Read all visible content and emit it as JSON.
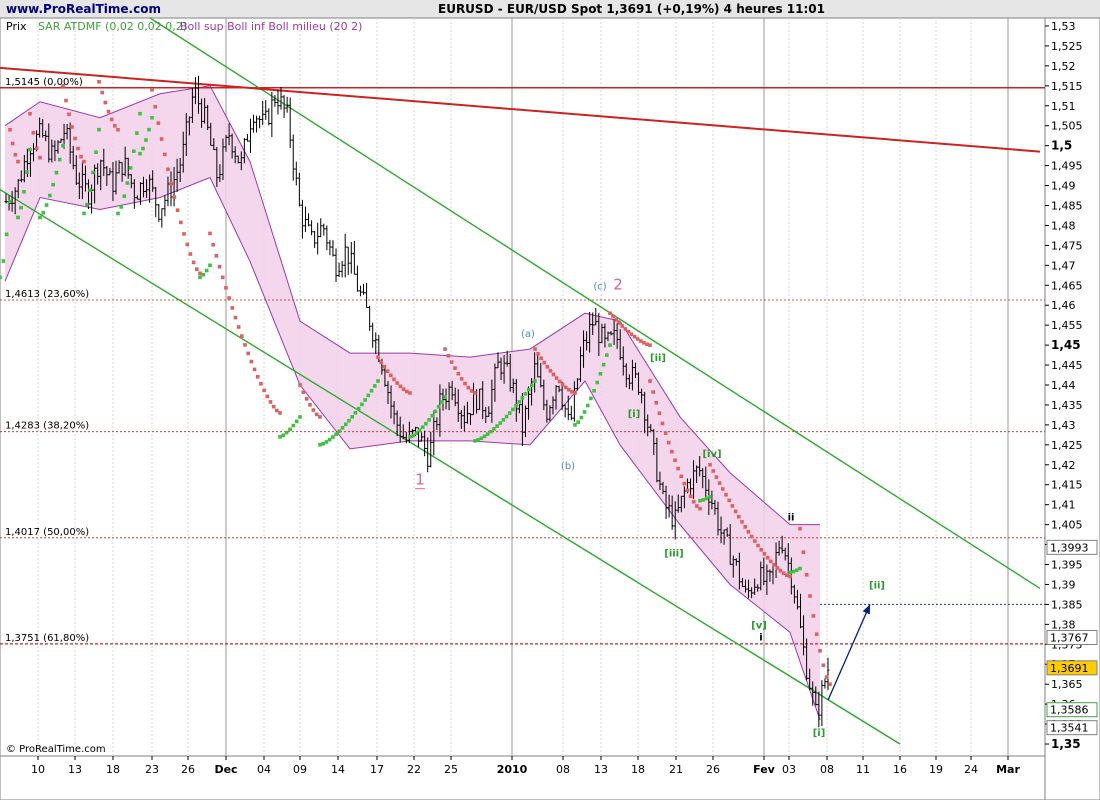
{
  "header": {
    "site": "www.ProRealTime.com",
    "title": "EURUSD - EUR/USD Spot    1,3691 (+0,19%)    4 heures  11:01"
  },
  "legend": {
    "prix": "Prix",
    "sar": "SAR ATDMF (0,02 0,02 0,2)",
    "boll": "Boll sup Boll inf Boll milieu (20 2)"
  },
  "footer": {
    "copyright": "© ProRealTime.com"
  },
  "colors": {
    "background": "#ffffff",
    "bars": "#000000",
    "sar_down": "#e06060",
    "sar_up": "#40c040",
    "boll_fill": "#f2d0ea",
    "boll_line": "#9a3aaa",
    "channel": "#2eaa2e",
    "trend": "#cc2222",
    "fib_line": "#cc2222",
    "arrow": "#002080",
    "wave_pink": "#e0609a",
    "wave_blue": "#4f86c8",
    "wave_green": "#2a9a2a",
    "wave_black": "#000000"
  },
  "chart_data": {
    "type": "candlestick",
    "title": "EURUSD - EUR/USD Spot",
    "interval": "4 heures",
    "last_price": 1.3691,
    "change": "+0,19%",
    "x_ticks": [
      "10",
      "13",
      "18",
      "23",
      "26",
      "Dec",
      "04",
      "09",
      "14",
      "17",
      "22",
      "25",
      "2010",
      "08",
      "13",
      "18",
      "21",
      "26",
      "Fev",
      "03",
      "08",
      "11",
      "16",
      "19",
      "24",
      "Mar"
    ],
    "y_range": [
      1.347,
      1.532
    ],
    "y_ticks": [
      "1,53",
      "1,525",
      "1,52",
      "1,515",
      "1,51",
      "1,505",
      "1,5",
      "1,495",
      "1,49",
      "1,485",
      "1,48",
      "1,475",
      "1,47",
      "1,465",
      "1,46",
      "1,455",
      "1,45",
      "1,445",
      "1,44",
      "1,435",
      "1,43",
      "1,425",
      "1,42",
      "1,415",
      "1,41",
      "1,405",
      "1,4",
      "1,395",
      "1,39",
      "1,385",
      "1,38",
      "1,375",
      "1,37",
      "1,365",
      "1,36",
      "1,355",
      "1,35"
    ],
    "price_path": [
      1.486,
      1.49,
      1.5,
      1.503,
      1.497,
      1.504,
      1.492,
      1.488,
      1.497,
      1.49,
      1.496,
      1.488,
      1.492,
      1.484,
      1.489,
      1.497,
      1.514,
      1.506,
      1.492,
      1.503,
      1.495,
      1.509,
      1.505,
      1.513,
      1.507,
      1.484,
      1.476,
      1.48,
      1.47,
      1.474,
      1.464,
      1.456,
      1.446,
      1.432,
      1.426,
      1.428,
      1.422,
      1.436,
      1.44,
      1.432,
      1.437,
      1.434,
      1.446,
      1.441,
      1.429,
      1.444,
      1.433,
      1.442,
      1.429,
      1.448,
      1.456,
      1.45,
      1.452,
      1.443,
      1.44,
      1.425,
      1.41,
      1.406,
      1.415,
      1.419,
      1.412,
      1.402,
      1.396,
      1.387,
      1.392,
      1.39,
      1.402,
      1.391,
      1.372,
      1.357,
      1.369
    ],
    "sar_segments": [
      {
        "dir": "up",
        "x": [
          0,
          10
        ],
        "y": [
          1.467,
          1.486
        ]
      },
      {
        "dir": "down",
        "x": [
          10,
          18
        ],
        "y": [
          1.504,
          1.496
        ]
      },
      {
        "dir": "up",
        "x": [
          18,
          30
        ],
        "y": [
          1.482,
          1.499
        ]
      },
      {
        "dir": "down",
        "x": [
          30,
          40
        ],
        "y": [
          1.508,
          1.497
        ]
      },
      {
        "dir": "up",
        "x": [
          40,
          63
        ],
        "y": [
          1.482,
          1.5
        ]
      },
      {
        "dir": "down",
        "x": [
          63,
          84
        ],
        "y": [
          1.515,
          1.496
        ]
      },
      {
        "dir": "up",
        "x": [
          84,
          99
        ],
        "y": [
          1.483,
          1.504
        ]
      },
      {
        "dir": "down",
        "x": [
          99,
          118
        ],
        "y": [
          1.516,
          1.504
        ]
      },
      {
        "dir": "up",
        "x": [
          118,
          140
        ],
        "y": [
          1.483,
          1.508
        ]
      },
      {
        "dir": "up",
        "x": [
          140,
          152
        ],
        "y": [
          1.498,
          1.507
        ]
      },
      {
        "dir": "down",
        "x": [
          152,
          200
        ],
        "y": [
          1.514,
          1.468
        ]
      },
      {
        "dir": "up",
        "x": [
          200,
          210
        ],
        "y": [
          1.467,
          1.47
        ]
      },
      {
        "dir": "down",
        "x": [
          210,
          280
        ],
        "y": [
          1.478,
          1.433
        ]
      },
      {
        "dir": "up",
        "x": [
          280,
          300
        ],
        "y": [
          1.427,
          1.432
        ]
      },
      {
        "dir": "down",
        "x": [
          300,
          320
        ],
        "y": [
          1.44,
          1.432
        ]
      },
      {
        "dir": "up",
        "x": [
          320,
          378
        ],
        "y": [
          1.425,
          1.441
        ]
      },
      {
        "dir": "down",
        "x": [
          378,
          410
        ],
        "y": [
          1.447,
          1.438
        ]
      },
      {
        "dir": "up",
        "x": [
          410,
          445
        ],
        "y": [
          1.427,
          1.437
        ]
      },
      {
        "dir": "down",
        "x": [
          445,
          475
        ],
        "y": [
          1.449,
          1.438
        ]
      },
      {
        "dir": "up",
        "x": [
          475,
          535
        ],
        "y": [
          1.426,
          1.441
        ]
      },
      {
        "dir": "down",
        "x": [
          535,
          575
        ],
        "y": [
          1.449,
          1.438
        ]
      },
      {
        "dir": "up",
        "x": [
          575,
          610
        ],
        "y": [
          1.43,
          1.45
        ]
      },
      {
        "dir": "down",
        "x": [
          610,
          650
        ],
        "y": [
          1.458,
          1.45
        ]
      },
      {
        "dir": "down",
        "x": [
          650,
          700
        ],
        "y": [
          1.441,
          1.409
        ]
      },
      {
        "dir": "up",
        "x": [
          700,
          710
        ],
        "y": [
          1.411,
          1.412
        ]
      },
      {
        "dir": "down",
        "x": [
          710,
          790
        ],
        "y": [
          1.42,
          1.392
        ]
      },
      {
        "dir": "up",
        "x": [
          790,
          800
        ],
        "y": [
          1.393,
          1.394
        ]
      },
      {
        "dir": "down",
        "x": [
          800,
          830
        ],
        "y": [
          1.404,
          1.365
        ]
      }
    ],
    "bollinger_upper": [
      [
        5,
        1.505
      ],
      [
        40,
        1.511
      ],
      [
        100,
        1.507
      ],
      [
        160,
        1.513
      ],
      [
        210,
        1.515
      ],
      [
        250,
        1.496
      ],
      [
        300,
        1.456
      ],
      [
        350,
        1.448
      ],
      [
        410,
        1.448
      ],
      [
        470,
        1.447
      ],
      [
        530,
        1.449
      ],
      [
        585,
        1.458
      ],
      [
        620,
        1.456
      ],
      [
        680,
        1.432
      ],
      [
        730,
        1.418
      ],
      [
        790,
        1.405
      ],
      [
        820,
        1.405
      ]
    ],
    "bollinger_lower": [
      [
        5,
        1.466
      ],
      [
        40,
        1.487
      ],
      [
        100,
        1.484
      ],
      [
        160,
        1.487
      ],
      [
        210,
        1.492
      ],
      [
        250,
        1.471
      ],
      [
        300,
        1.44
      ],
      [
        350,
        1.424
      ],
      [
        410,
        1.426
      ],
      [
        470,
        1.426
      ],
      [
        530,
        1.425
      ],
      [
        585,
        1.441
      ],
      [
        620,
        1.425
      ],
      [
        680,
        1.405
      ],
      [
        730,
        1.39
      ],
      [
        790,
        1.378
      ],
      [
        820,
        1.356
      ]
    ],
    "fibonacci": [
      {
        "label": "1,5145 (0,00%)",
        "value": 1.5145
      },
      {
        "label": "1,4613 (23,60%)",
        "value": 1.4613
      },
      {
        "label": "1,4283 (38,20%)",
        "value": 1.4283
      },
      {
        "label": "1,4017 (50,00%)",
        "value": 1.4017
      },
      {
        "label": "1,3751 (61,80%)",
        "value": 1.3751
      }
    ],
    "target_level": 1.385,
    "price_tags": [
      {
        "label": "1,3993",
        "value": 1.3993,
        "style": "plain"
      },
      {
        "label": "1,3767",
        "value": 1.3767,
        "style": "plain"
      },
      {
        "label": "1,3691",
        "value": 1.3691,
        "style": "last"
      },
      {
        "label": "1,3586",
        "value": 1.3586,
        "style": "green"
      },
      {
        "label": "1,3541",
        "value": 1.3541,
        "style": "plain"
      }
    ],
    "channel_upper": [
      [
        150,
        1.532
      ],
      [
        1040,
        1.389
      ]
    ],
    "channel_lower": [
      [
        0,
        1.489
      ],
      [
        900,
        1.35
      ]
    ],
    "trendline": [
      [
        0,
        1.5195
      ],
      [
        1040,
        1.4985
      ]
    ],
    "wave_labels": [
      {
        "text": "1",
        "x": 420,
        "y": 1.415,
        "color": "pink"
      },
      {
        "text": "2",
        "x": 618,
        "y": 1.464,
        "color": "pink"
      },
      {
        "text": "(a)",
        "x": 528,
        "y": 1.452,
        "color": "blue"
      },
      {
        "text": "(b)",
        "x": 568,
        "y": 1.419,
        "color": "blue"
      },
      {
        "text": "(c)",
        "x": 600,
        "y": 1.464,
        "color": "blue"
      },
      {
        "text": "[ii]",
        "x": 658,
        "y": 1.446,
        "color": "green"
      },
      {
        "text": "[i]",
        "x": 634,
        "y": 1.432,
        "color": "green"
      },
      {
        "text": "[iv]",
        "x": 712,
        "y": 1.422,
        "color": "green"
      },
      {
        "text": "[iii]",
        "x": 674,
        "y": 1.397,
        "color": "green"
      },
      {
        "text": "[v]",
        "x": 759,
        "y": 1.379,
        "color": "green"
      },
      {
        "text": "[ii]",
        "x": 877,
        "y": 1.389,
        "color": "green"
      },
      {
        "text": "[i]",
        "x": 819,
        "y": 1.352,
        "color": "green"
      },
      {
        "text": "ii",
        "x": 791,
        "y": 1.406,
        "color": "black"
      },
      {
        "text": "i",
        "x": 761,
        "y": 1.376,
        "color": "black"
      }
    ],
    "arrow": {
      "from": [
        828,
        1.361
      ],
      "to": [
        870,
        1.385
      ]
    },
    "xlabel": "",
    "ylabel": ""
  }
}
